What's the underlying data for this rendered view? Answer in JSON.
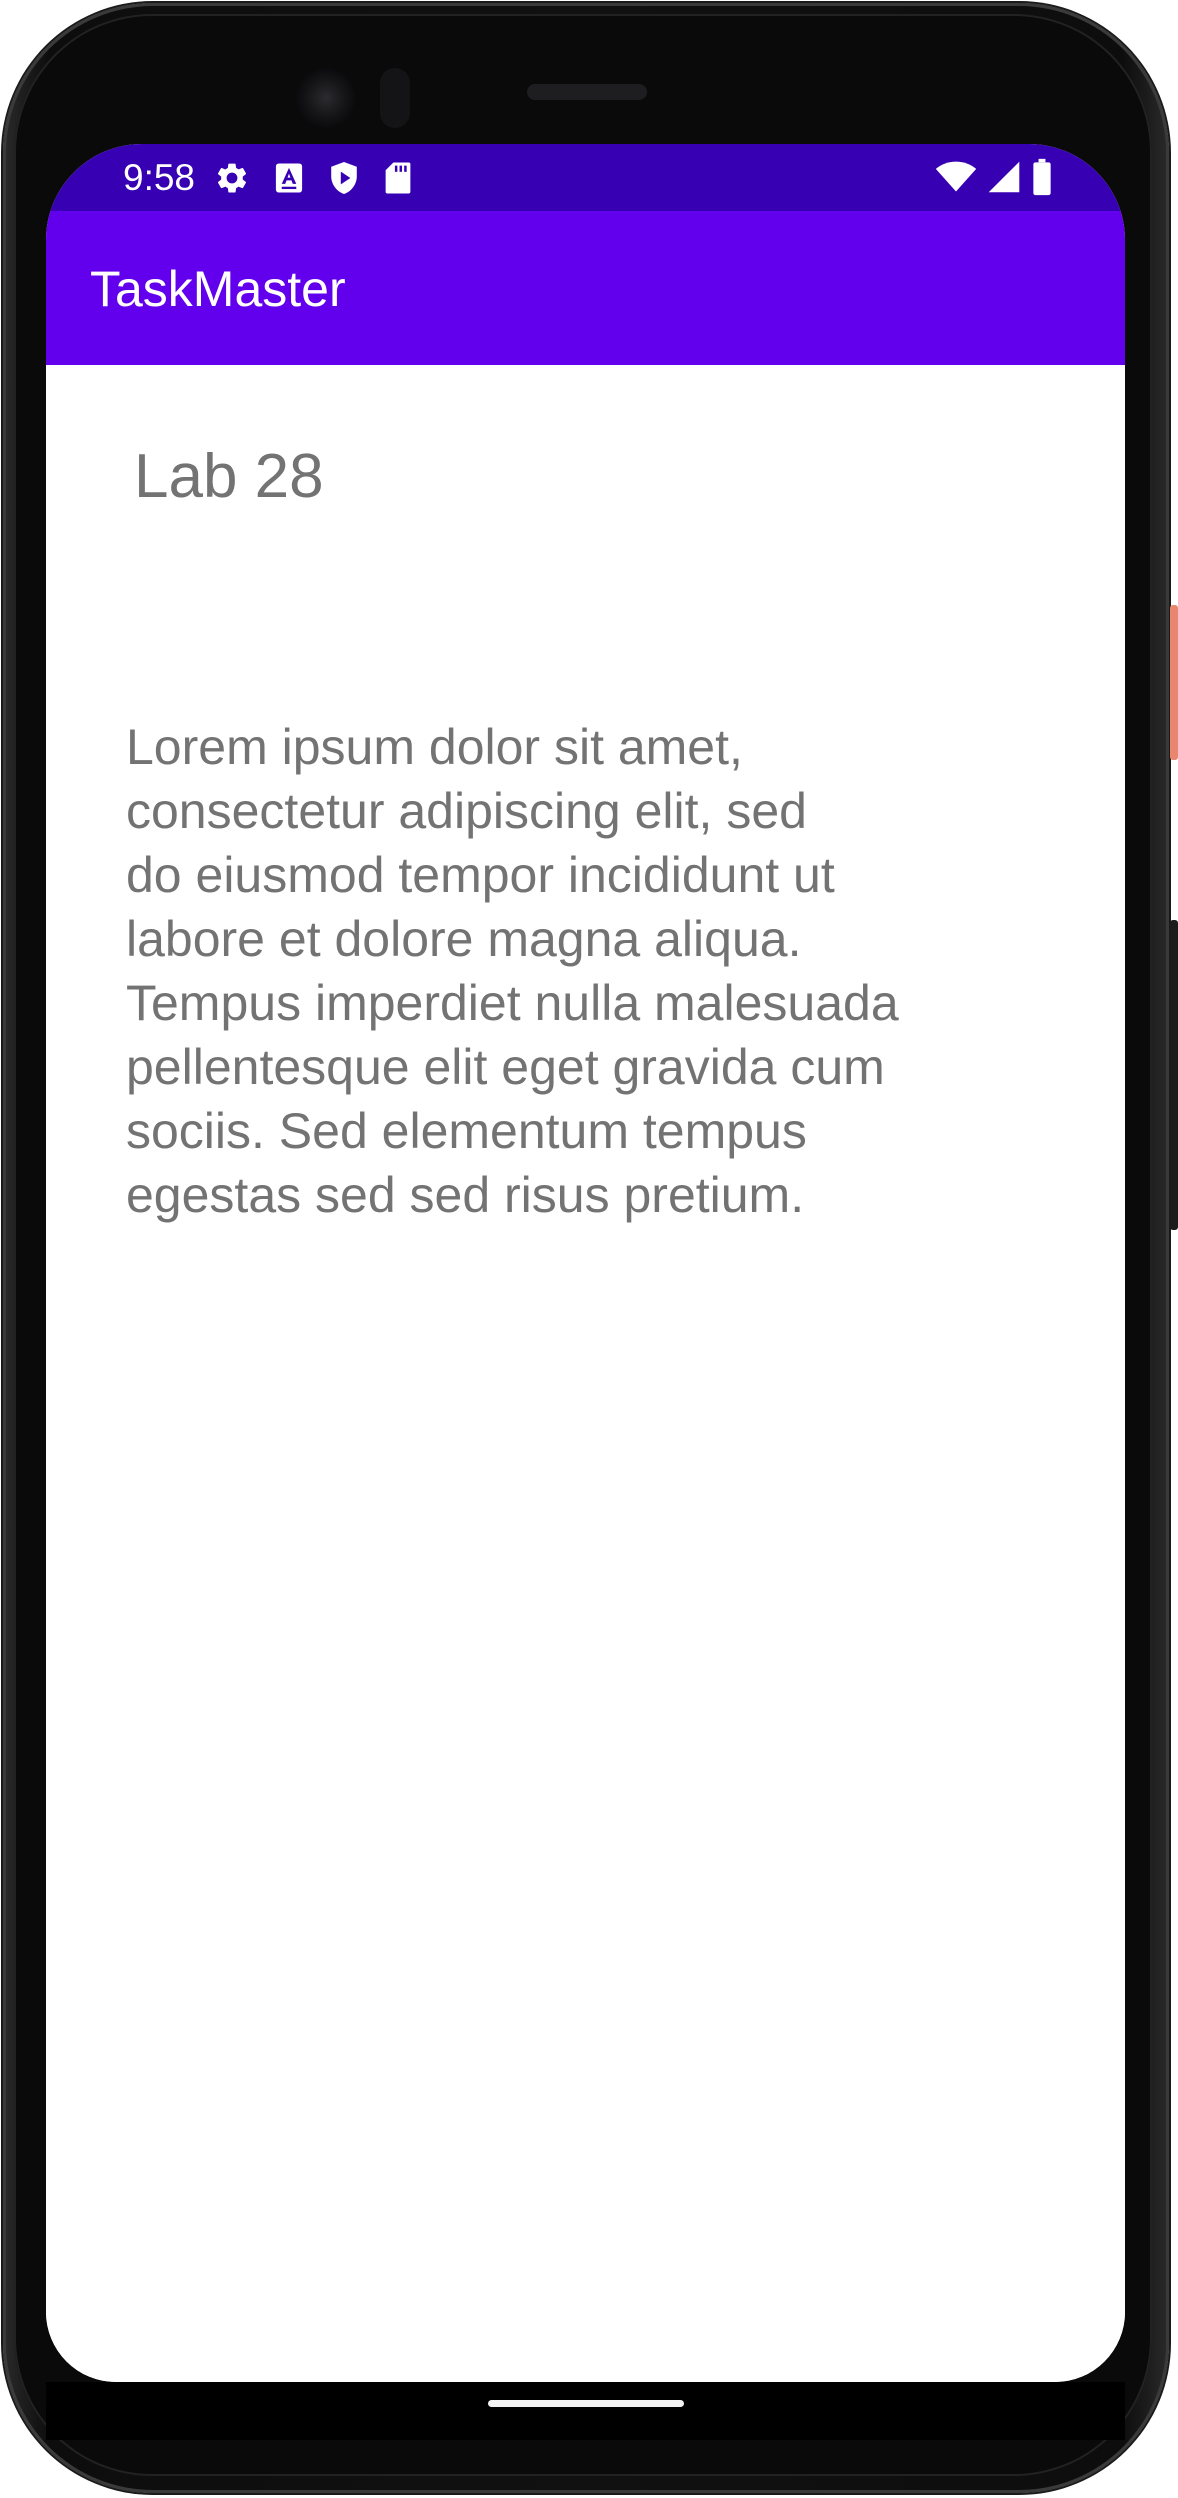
{
  "status_bar": {
    "time": "9:58",
    "left_icons": [
      "gear-icon",
      "a-text-icon",
      "shield-play-icon",
      "sd-card-icon"
    ],
    "right_icons": [
      "wifi-icon",
      "cell-signal-icon",
      "battery-icon"
    ]
  },
  "app_bar": {
    "title": "TaskMaster"
  },
  "task": {
    "title": "Lab 28",
    "body": "Lorem ipsum dolor sit amet,\nconsectetur adipiscing elit, sed\ndo eiusmod tempor incididunt ut\nlabore et dolore magna aliqua.\nTempus imperdiet nulla malesuada\npellentesque elit eget gravida cum\nsociis. Sed elementum tempus\negestas sed sed risus pretium."
  },
  "colors": {
    "status_bar": "#3700b3",
    "app_bar": "#6200ee",
    "text_secondary": "#737373"
  }
}
